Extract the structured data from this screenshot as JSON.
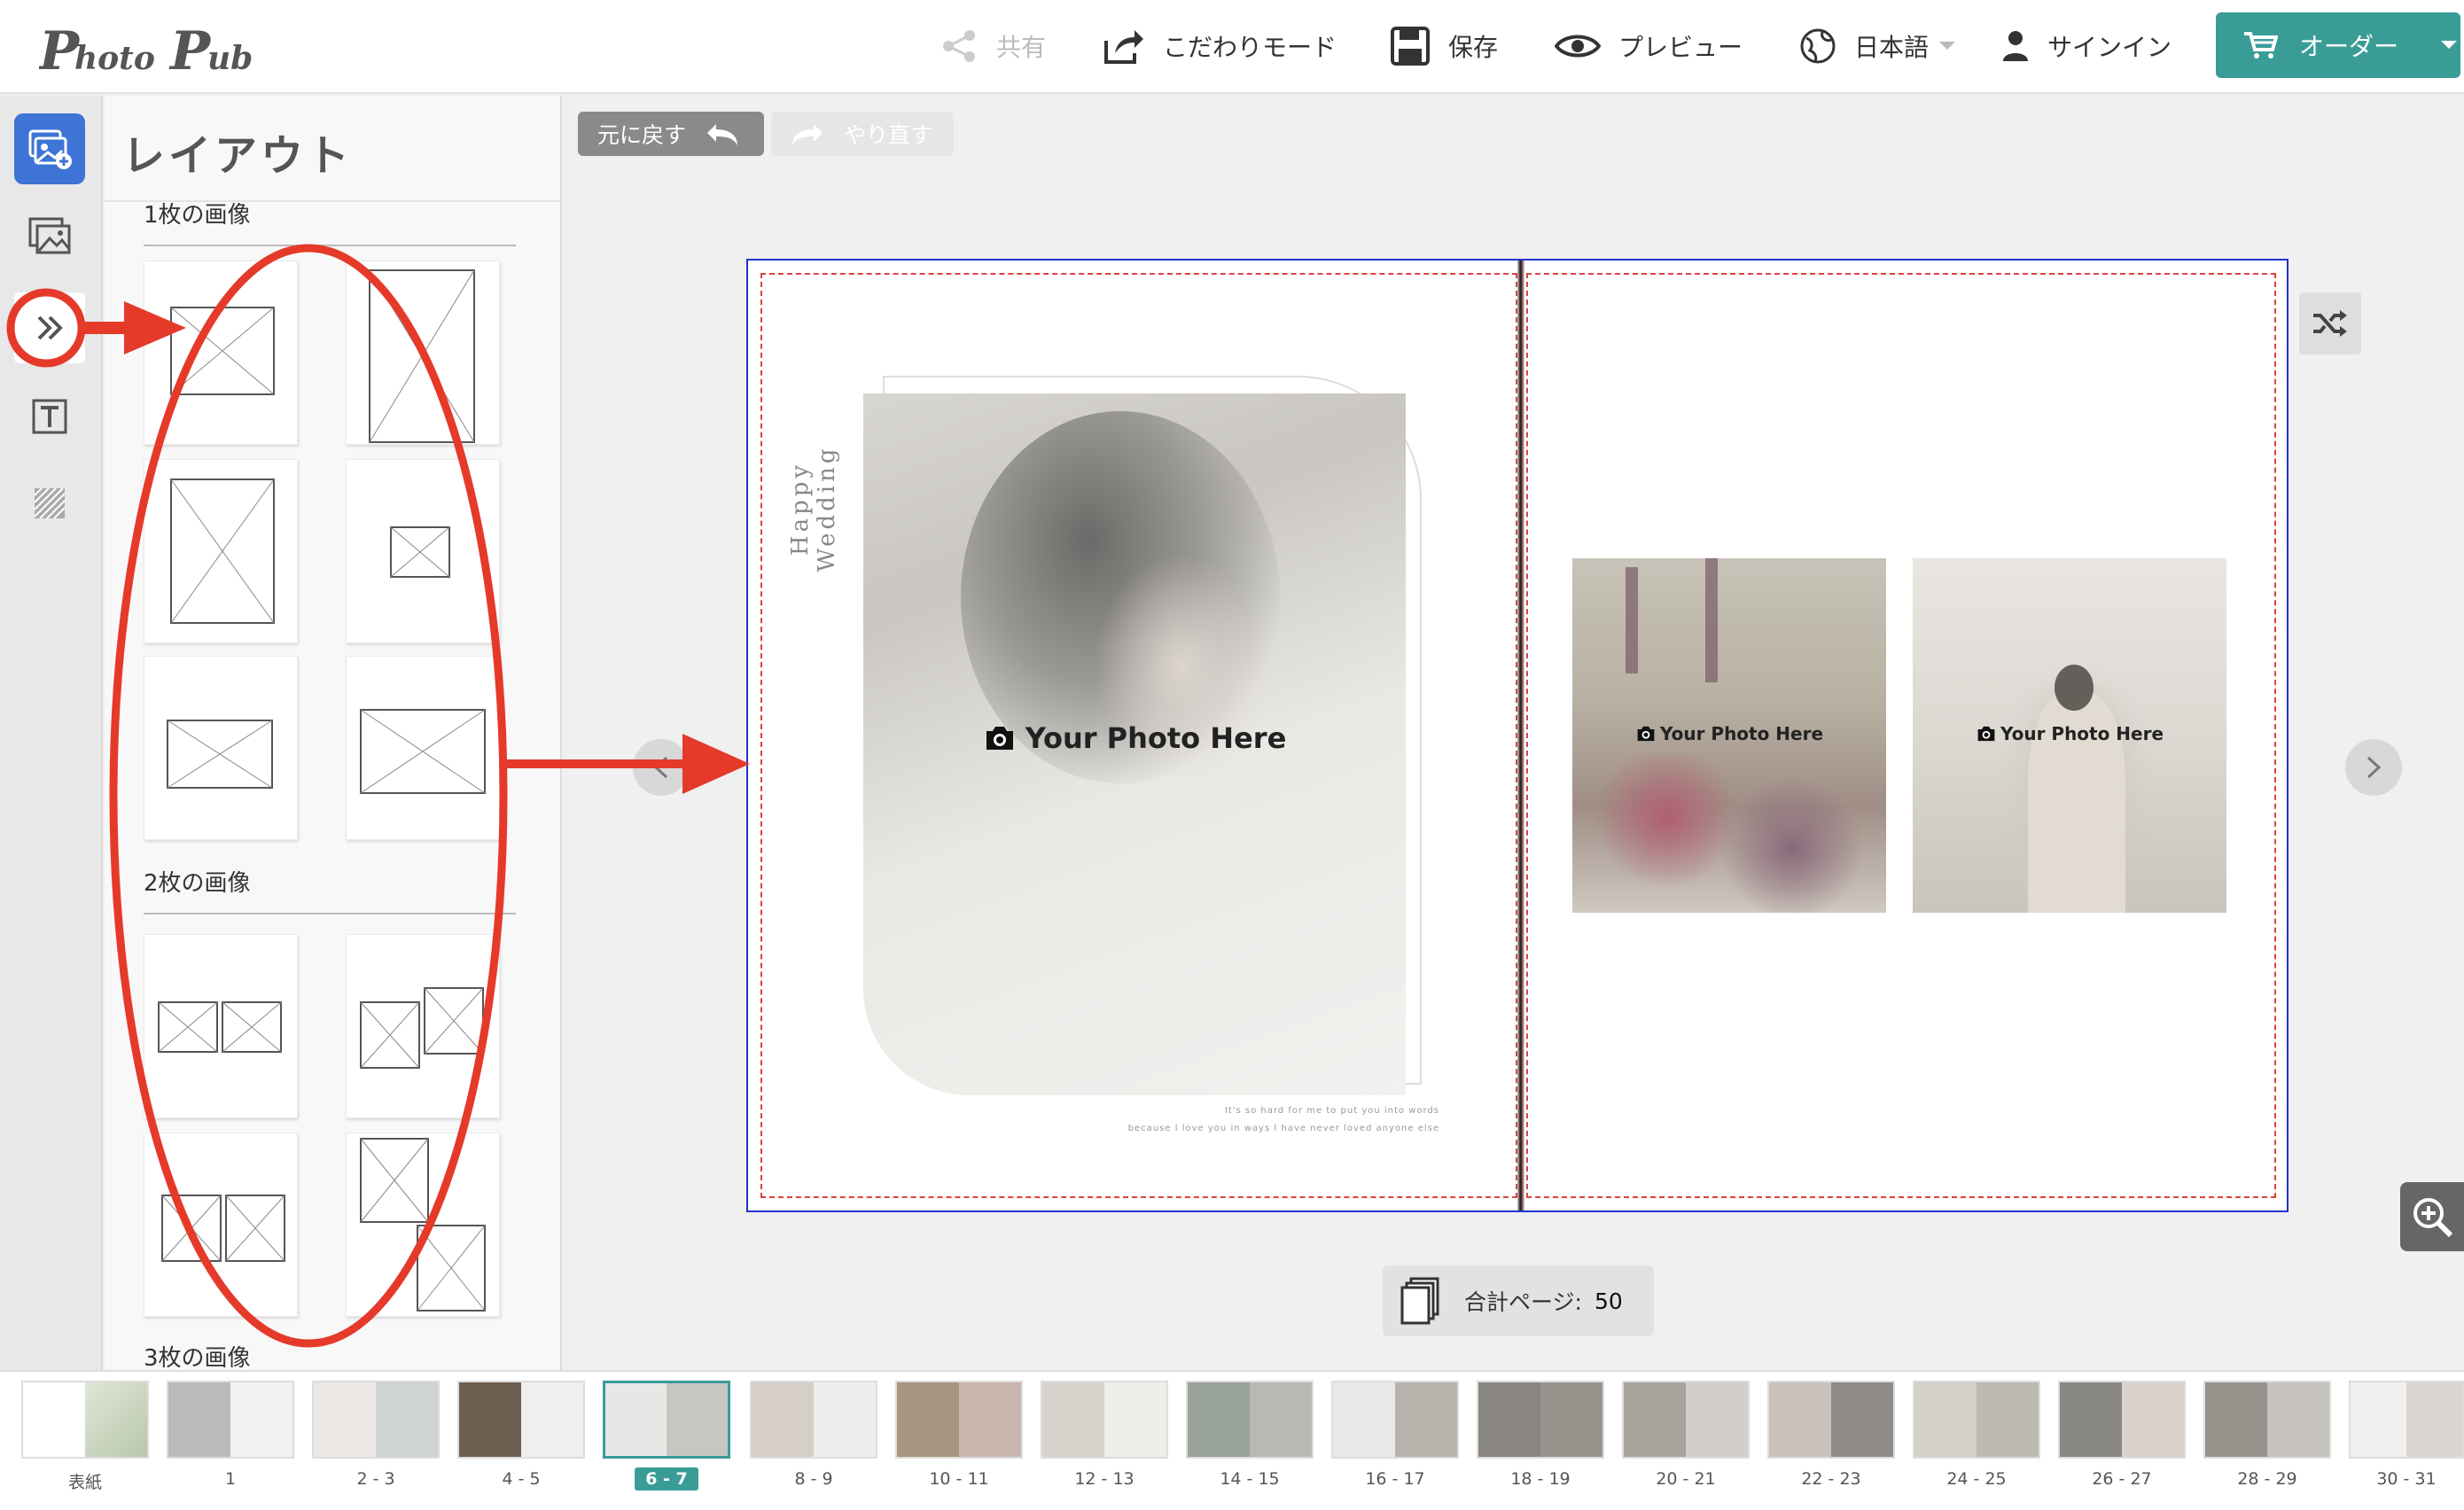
{
  "app": {
    "logo_text": "PhotoPub"
  },
  "header": {
    "share_label": "共有",
    "advanced_label": "こだわりモード",
    "save_label": "保存",
    "preview_label": "プレビュー",
    "language_label": "日本語",
    "signin_label": "サインイン",
    "order_label": "オーダー"
  },
  "rail": {
    "items": [
      "photo-add-icon",
      "image-icon",
      "layout-icon",
      "text-icon",
      "pattern-icon"
    ]
  },
  "panel": {
    "title": "レイアウト",
    "sections": [
      {
        "label": "1枚の画像"
      },
      {
        "label": "2枚の画像"
      },
      {
        "label": "3枚の画像"
      }
    ]
  },
  "toolbar": {
    "undo_label": "元に戻す",
    "redo_label": "やり直す"
  },
  "spread": {
    "left_vertical_text": "Happy Wedding",
    "main_photo_placeholder": "Your Photo Here",
    "caption_line1": "It's so hard for me to put you into words",
    "caption_line2": "because I love you in ways I have never loved anyone else",
    "right_photo1_placeholder": "Your Photo Here",
    "right_photo2_placeholder": "Your Photo Here"
  },
  "footer": {
    "total_pages_label": "合計ページ:",
    "total_pages_value": "50"
  },
  "thumbnails": [
    {
      "label": "表紙",
      "active": false
    },
    {
      "label": "1",
      "active": false
    },
    {
      "label": "2 - 3",
      "active": false
    },
    {
      "label": "4 - 5",
      "active": false
    },
    {
      "label": "6 - 7",
      "active": true
    },
    {
      "label": "8 - 9",
      "active": false
    },
    {
      "label": "10 - 11",
      "active": false
    },
    {
      "label": "12 - 13",
      "active": false
    },
    {
      "label": "14 - 15",
      "active": false
    },
    {
      "label": "16 - 17",
      "active": false
    },
    {
      "label": "18 - 19",
      "active": false
    },
    {
      "label": "20 - 21",
      "active": false
    },
    {
      "label": "22 - 23",
      "active": false
    },
    {
      "label": "24 - 25",
      "active": false
    },
    {
      "label": "26 - 27",
      "active": false
    },
    {
      "label": "28 - 29",
      "active": false
    },
    {
      "label": "30 - 31",
      "active": false
    }
  ],
  "colors": {
    "accent": "#3a9c97",
    "rail_active": "#3d74d6",
    "annotation": "#e53a2a",
    "spread_border": "#2233cc",
    "safe_line": "#e04040"
  }
}
